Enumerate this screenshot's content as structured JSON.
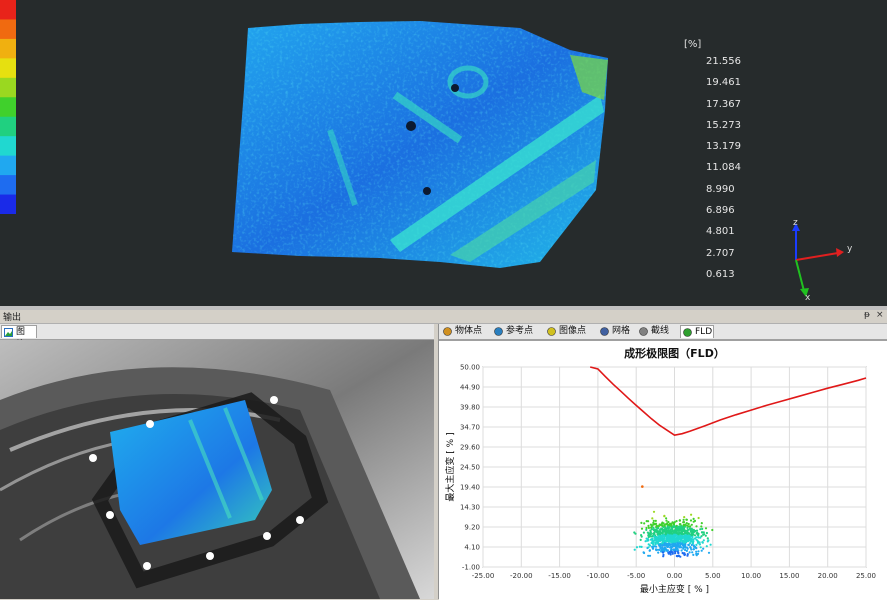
{
  "legend": {
    "unit": "[%]",
    "values": [
      "21.556",
      "19.461",
      "17.367",
      "15.273",
      "13.179",
      "11.084",
      "8.990",
      "6.896",
      "4.801",
      "2.707",
      "0.613"
    ],
    "colors": [
      "#e8231a",
      "#f06a10",
      "#f0b010",
      "#e6e010",
      "#9ad820",
      "#40d02c",
      "#20d080",
      "#20d8d0",
      "#20a8f0",
      "#1e6cf0",
      "#1a2ae8"
    ]
  },
  "axes_triad": {
    "z": "z",
    "y": "y",
    "x": "x"
  },
  "output_bar": {
    "title": "输出",
    "pin": "ᵽ",
    "close": "×"
  },
  "left_tabs": [
    {
      "label": "图片",
      "icon": "picture-icon"
    }
  ],
  "right_tabs": [
    {
      "label": "物体点",
      "icon": "object-points-icon"
    },
    {
      "label": "参考点",
      "icon": "reference-points-icon"
    },
    {
      "label": "图像点",
      "icon": "image-points-icon"
    },
    {
      "label": "网格",
      "icon": "grid-icon"
    },
    {
      "label": "截线",
      "icon": "section-line-icon"
    },
    {
      "label": "FLD",
      "icon": "chart-icon"
    }
  ],
  "chart_data": {
    "type": "scatter",
    "title": "成形极限图（FLD）",
    "xlabel": "最小主应变 [ % ]",
    "ylabel": "最大主应变 [ % ]",
    "xlim": [
      -25,
      25
    ],
    "ylim": [
      -1,
      50
    ],
    "x_ticks": [
      "-25.00",
      "-20.00",
      "-15.00",
      "-10.00",
      "-5.00",
      "0.00",
      "5.00",
      "10.00",
      "15.00",
      "20.00",
      "25.00"
    ],
    "y_ticks": [
      "50.00",
      "44.90",
      "39.80",
      "34.70",
      "29.60",
      "24.50",
      "19.40",
      "14.30",
      "9.20",
      "4.10",
      "-1.00"
    ],
    "grid": true,
    "flc_curve": {
      "x": [
        -11,
        -10,
        -9,
        -8,
        -7,
        -6,
        -5,
        -4,
        -3,
        -2,
        -1,
        0,
        1,
        2,
        4,
        6,
        8,
        10,
        12,
        14,
        16,
        18,
        20,
        22,
        24,
        25
      ],
      "y": [
        50.2,
        49.5,
        47.5,
        45.6,
        43.8,
        42.0,
        40.2,
        38.5,
        36.8,
        35.2,
        33.9,
        32.6,
        33.0,
        33.6,
        35.0,
        36.5,
        37.8,
        39.0,
        40.2,
        41.3,
        42.4,
        43.5,
        44.6,
        45.6,
        46.6,
        47.2
      ]
    },
    "point_cloud": {
      "center_x": 0.0,
      "center_y": 6.5,
      "spread_x": 3.6,
      "spread_y": 4.2,
      "outlier": [
        -4.2,
        19.5
      ]
    }
  }
}
